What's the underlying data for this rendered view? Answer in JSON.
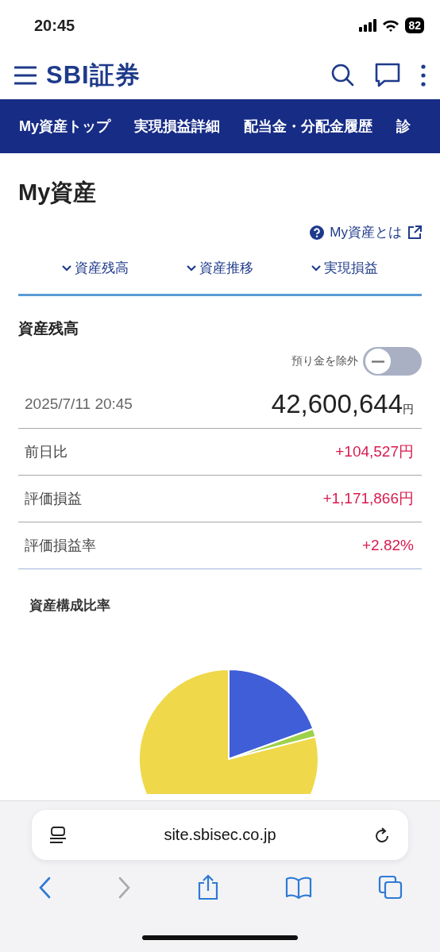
{
  "status_bar": {
    "time": "20:45",
    "battery": "82"
  },
  "header": {
    "logo": "SBI証券"
  },
  "nav_tabs": [
    {
      "label": "My資産トップ"
    },
    {
      "label": "実現損益詳細"
    },
    {
      "label": "配当金・分配金履歴"
    },
    {
      "label": "診"
    }
  ],
  "page_title": "My資産",
  "help_link": "My資産とは",
  "anchor_links": [
    "資産残高",
    "資産推移",
    "実現損益"
  ],
  "balance": {
    "heading": "資産残高",
    "exclude_deposits": {
      "label": "預り金を除外",
      "on": false
    },
    "date": "2025/7/11 20:45",
    "total": "42,600,644",
    "unit": "円",
    "rows": [
      {
        "label": "前日比",
        "value": "+104,527円"
      },
      {
        "label": "評価損益",
        "value": "+1,171,866円"
      },
      {
        "label": "評価損益率",
        "value": "+2.82%"
      }
    ]
  },
  "composition": {
    "heading": "資産構成比率"
  },
  "browser": {
    "url": "site.sbisec.co.jp"
  }
}
